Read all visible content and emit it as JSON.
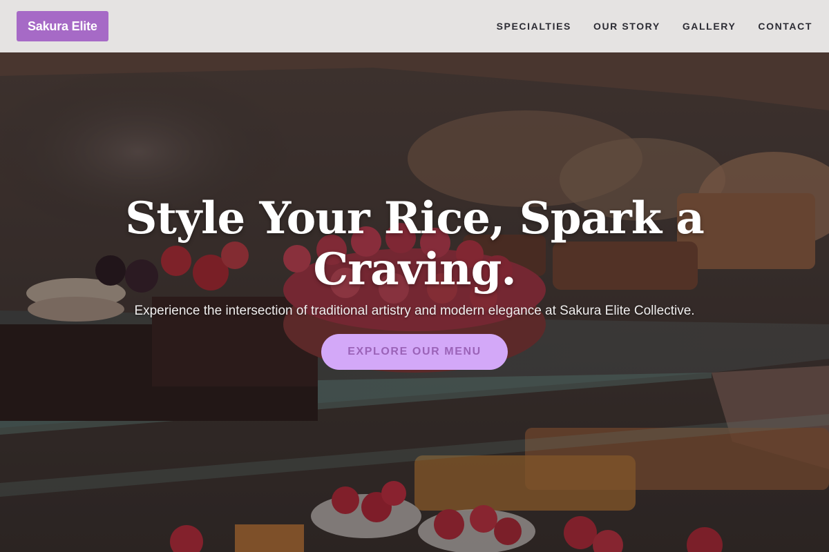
{
  "brand": {
    "label": "Sakura Elite",
    "color": "#a66ac6"
  },
  "nav": {
    "links": [
      {
        "label": "SPECIALTIES"
      },
      {
        "label": "OUR STORY"
      },
      {
        "label": "GALLERY"
      },
      {
        "label": "CONTACT"
      }
    ]
  },
  "hero": {
    "title": "Style Your Rice, Spark a Craving.",
    "subtitle": "Experience the intersection of traditional artistry and modern elegance at Sakura Elite Collective.",
    "cta_label": "EXPLORE OUR MENU",
    "cta_color": "#d3a8f8",
    "background": "pastry-display-case-photo"
  }
}
